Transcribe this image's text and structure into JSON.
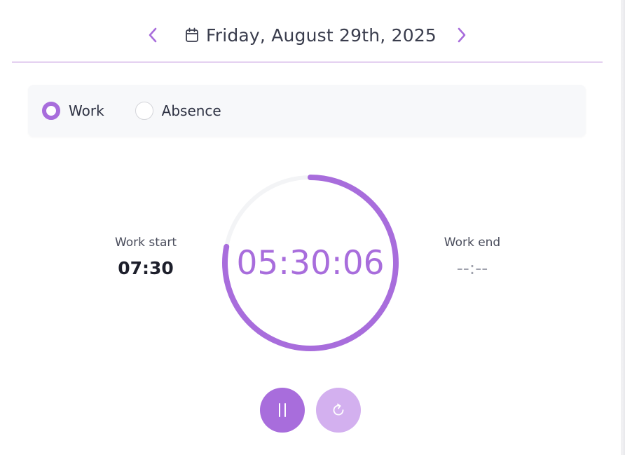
{
  "header": {
    "date": "Friday, August 29th, 2025",
    "prev_icon": "chevron-left-icon",
    "next_icon": "chevron-right-icon",
    "calendar_icon": "calendar-icon"
  },
  "entry_type": {
    "options": [
      {
        "label": "Work",
        "selected": true
      },
      {
        "label": "Absence",
        "selected": false
      }
    ]
  },
  "timer": {
    "elapsed": "05:30:06",
    "progress": 0.78,
    "work_start": {
      "label": "Work start",
      "value": "07:30"
    },
    "work_end": {
      "label": "Work end",
      "value": "--:--"
    }
  },
  "controls": {
    "pause_icon": "pause-icon",
    "reset_icon": "refresh-icon"
  },
  "colors": {
    "accent": "#a86ddc",
    "accent_light": "#d3b0ef",
    "divider": "#b57fd8"
  }
}
